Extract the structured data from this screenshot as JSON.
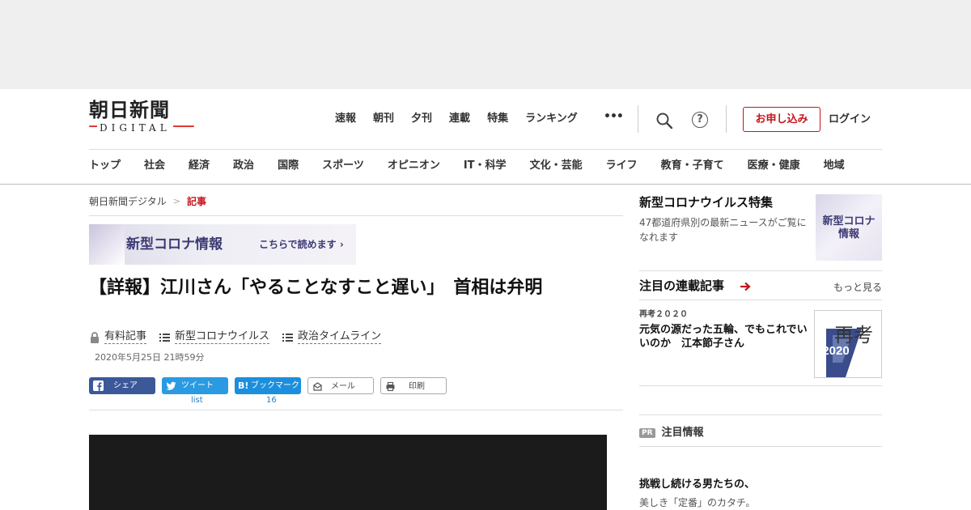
{
  "masthead": {
    "logo_main": "朝日新聞",
    "logo_sub": "DIGITAL",
    "top_nav": [
      "速報",
      "朝刊",
      "夕刊",
      "連載",
      "特集",
      "ランキング"
    ],
    "more": "•••",
    "help_glyph": "?",
    "apply_label": "お申し込み",
    "login_label": "ログイン"
  },
  "categories": [
    "トップ",
    "社会",
    "経済",
    "政治",
    "国際",
    "スポーツ",
    "オピニオン",
    "IT・科学",
    "文化・芸能",
    "ライフ",
    "教育・子育て",
    "医療・健康",
    "地域"
  ],
  "breadcrumb": {
    "home": "朝日新聞デジタル",
    "separator": ">",
    "current": "記事"
  },
  "banner": {
    "title": "新型コロナ情報",
    "link": "こちらで読めます ›"
  },
  "article": {
    "headline": "【詳報】江川さん「やることなすこと遅い」　首相は弁明",
    "tags": [
      "有料記事",
      "新型コロナウイルス",
      "政治タイムライン"
    ],
    "date": "2020年5月25日 21時59分"
  },
  "share": {
    "facebook": "シェア",
    "twitter": "ツイート",
    "twitter_count": "list",
    "hatena": "ブックマーク",
    "hatena_count": "16",
    "mail": "メール",
    "print": "印刷"
  },
  "sidebar": {
    "feature": {
      "title": "新型コロナウイルス特集",
      "desc": "47都道府県別の最新ニュースがご覧になれます",
      "thumb_text": "新型コロナ\n情報"
    },
    "serial": {
      "title": "注目の連載記事",
      "more": "もっと見る",
      "kicker": "再考２０２０",
      "article_title": "元気の源だった五輪、でもこれでいいのか　江本節子さん",
      "thumb_main": "再考",
      "thumb_year": "2020"
    },
    "pr": {
      "badge": "PR",
      "label": "注目情報"
    },
    "ad": {
      "title": "挑戦し続ける男たちの、",
      "desc": "美しき「定番」のカタチ。"
    }
  },
  "colors": {
    "brand_red": "#c4161c",
    "facebook": "#3b5998",
    "twitter": "#2a9ae2",
    "hatena": "#1b8fdd",
    "corona_purple": "#3d3a73"
  }
}
